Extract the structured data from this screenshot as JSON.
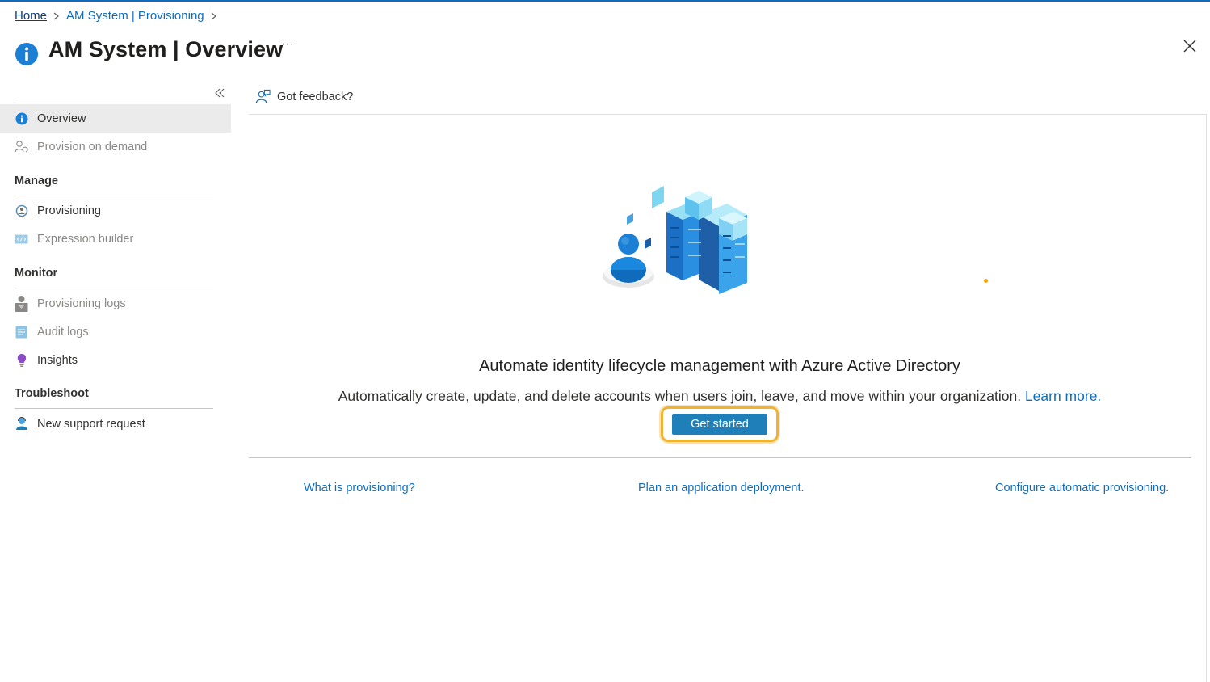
{
  "breadcrumb": {
    "home": "Home",
    "parent": "AM System | Provisioning"
  },
  "header": {
    "title": "AM System | Overview",
    "more": "···"
  },
  "sidebar": {
    "items_top": [
      {
        "label": "Overview",
        "icon": "info-icon",
        "active": true
      },
      {
        "label": "Provision on demand",
        "icon": "user-sync-icon"
      }
    ],
    "sections": {
      "manage": "Manage",
      "monitor": "Monitor",
      "troubleshoot": "Troubleshoot"
    },
    "manage_items": [
      {
        "label": "Provisioning",
        "icon": "provisioning-icon"
      },
      {
        "label": "Expression builder",
        "icon": "expression-icon"
      }
    ],
    "monitor_items": [
      {
        "label": "Provisioning logs",
        "icon": "logs-user-icon"
      },
      {
        "label": "Audit logs",
        "icon": "audit-log-icon"
      },
      {
        "label": "Insights",
        "icon": "insights-bulb-icon"
      }
    ],
    "troubleshoot_items": [
      {
        "label": "New support request",
        "icon": "support-person-icon"
      }
    ]
  },
  "main": {
    "feedback": "Got feedback?",
    "headline": "Automate identity lifecycle management with Azure Active Directory",
    "subline": "Automatically create, update, and delete accounts when users join, leave, and move within your organization.",
    "learn_more": "Learn more.",
    "cta": "Get started",
    "links": [
      "What is provisioning?",
      "Plan an application deployment.",
      "Configure automatic provisioning."
    ]
  },
  "colors": {
    "accent": "#0f6cbd",
    "button": "#1f7fb8",
    "highlight": "#f0b232"
  }
}
